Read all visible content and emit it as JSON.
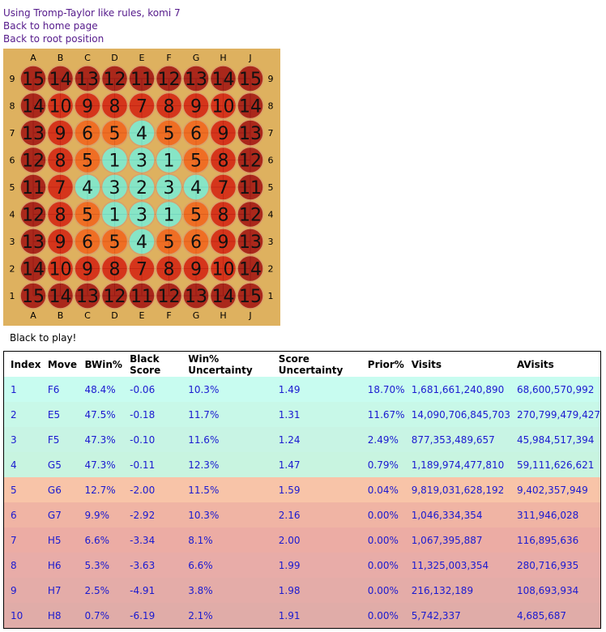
{
  "header": {
    "rules_text": "Using Tromp-Taylor like rules, komi 7",
    "home_link": "Back to home page",
    "root_link": "Back to root position"
  },
  "board": {
    "columns": [
      "A",
      "B",
      "C",
      "D",
      "E",
      "F",
      "G",
      "H",
      "J"
    ],
    "rows": [
      "9",
      "8",
      "7",
      "6",
      "5",
      "4",
      "3",
      "2",
      "1"
    ],
    "cells": [
      [
        15,
        14,
        13,
        12,
        11,
        12,
        13,
        14,
        15
      ],
      [
        14,
        10,
        9,
        8,
        7,
        8,
        9,
        10,
        14
      ],
      [
        13,
        9,
        6,
        5,
        4,
        5,
        6,
        9,
        13
      ],
      [
        12,
        8,
        5,
        1,
        3,
        1,
        5,
        8,
        12
      ],
      [
        11,
        7,
        4,
        3,
        2,
        3,
        4,
        7,
        11
      ],
      [
        12,
        8,
        5,
        1,
        3,
        1,
        5,
        8,
        12
      ],
      [
        13,
        9,
        6,
        5,
        4,
        5,
        6,
        9,
        13
      ],
      [
        14,
        10,
        9,
        8,
        7,
        8,
        9,
        10,
        14
      ],
      [
        15,
        14,
        13,
        12,
        11,
        12,
        13,
        14,
        15
      ]
    ],
    "colors": {
      "background": "#deb15f",
      "best": "#7fe9cf",
      "good": "#f06820",
      "bad": "#d42a16",
      "worst": "#a51c16"
    }
  },
  "status": {
    "to_play": "Black to play!"
  },
  "table": {
    "headers": [
      "Index",
      "Move",
      "BWin%",
      "Black Score",
      "Win% Uncertainty",
      "Score Uncertainty",
      "Prior%",
      "Visits",
      "AVisits"
    ],
    "rows": [
      [
        "1",
        "F6",
        "48.4%",
        "-0.06",
        "10.3%",
        "1.49",
        "18.70%",
        "1,681,661,240,890",
        "68,600,570,992"
      ],
      [
        "2",
        "E5",
        "47.5%",
        "-0.18",
        "11.7%",
        "1.31",
        "11.67%",
        "14,090,706,845,703",
        "270,799,479,427"
      ],
      [
        "3",
        "F5",
        "47.3%",
        "-0.10",
        "11.6%",
        "1.24",
        "2.49%",
        "877,353,489,657",
        "45,984,517,394"
      ],
      [
        "4",
        "G5",
        "47.3%",
        "-0.11",
        "12.3%",
        "1.47",
        "0.79%",
        "1,189,974,477,810",
        "59,111,626,621"
      ],
      [
        "5",
        "G6",
        "12.7%",
        "-2.00",
        "11.5%",
        "1.59",
        "0.04%",
        "9,819,031,628,192",
        "9,402,357,949"
      ],
      [
        "6",
        "G7",
        "9.9%",
        "-2.92",
        "10.3%",
        "2.16",
        "0.00%",
        "1,046,334,354",
        "311,946,028"
      ],
      [
        "7",
        "H5",
        "6.6%",
        "-3.34",
        "8.1%",
        "2.00",
        "0.00%",
        "1,067,395,887",
        "116,895,636"
      ],
      [
        "8",
        "H6",
        "5.3%",
        "-3.63",
        "6.6%",
        "1.99",
        "0.00%",
        "11,325,003,354",
        "280,716,935"
      ],
      [
        "9",
        "H7",
        "2.5%",
        "-4.91",
        "3.8%",
        "1.98",
        "0.00%",
        "216,132,189",
        "108,693,934"
      ],
      [
        "10",
        "H8",
        "0.7%",
        "-6.19",
        "2.1%",
        "1.91",
        "0.00%",
        "5,742,337",
        "4,685,687"
      ]
    ],
    "row_colors": [
      "#c8fcf0",
      "#c8f8e8",
      "#c8f4e4",
      "#c8f4e0",
      "#f8c4a8",
      "#f0b4a4",
      "#ecaca4",
      "#e8aca8",
      "#e4aca8",
      "#e0aca8"
    ]
  }
}
